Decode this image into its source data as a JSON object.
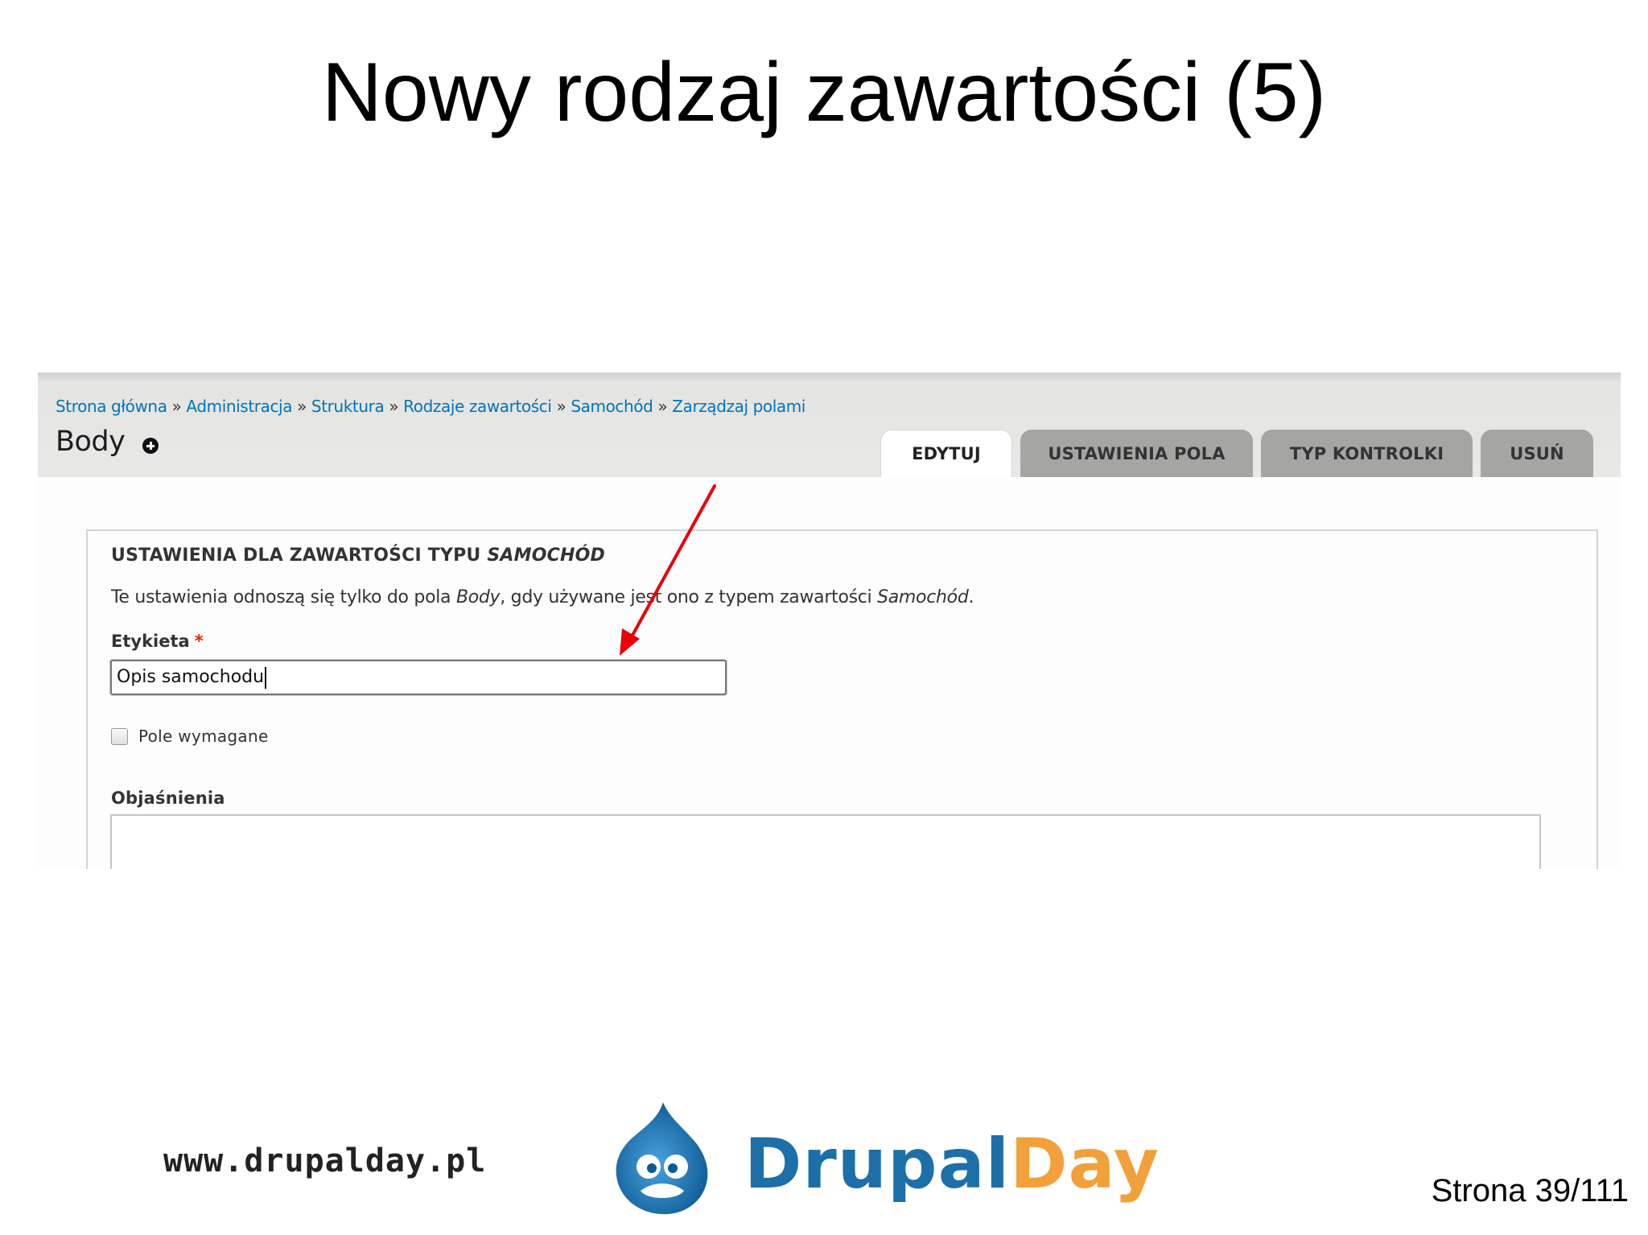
{
  "slide": {
    "title": "Nowy rodzaj zawartości (5)",
    "footer_url": "www.drupalday.pl",
    "logo_word1": "Drupal",
    "logo_word2": "Day",
    "page_number": "Strona 39/111"
  },
  "breadcrumb": {
    "items": [
      "Strona główna",
      "Administracja",
      "Struktura",
      "Rodzaje zawartości",
      "Samochód",
      "Zarządzaj polami"
    ],
    "separator": "»"
  },
  "header": {
    "title": "Body",
    "icon": "plus-circle-icon"
  },
  "tabs": [
    {
      "label": "EDYTUJ",
      "active": true
    },
    {
      "label": "USTAWIENIA POLA",
      "active": false
    },
    {
      "label": "TYP KONTROLKI",
      "active": false
    },
    {
      "label": "USUŃ",
      "active": false
    }
  ],
  "form": {
    "legend_prefix": "USTAWIENIA DLA ZAWARTOŚCI TYPU",
    "legend_type": "SAMOCHÓD",
    "description_part1": "Te ustawienia odnoszą się tylko do pola",
    "description_field": "Body",
    "description_part2": ", gdy używane jest ono z typem zawartości",
    "description_type": "Samochód",
    "description_end": ".",
    "label_field": "Etykieta",
    "required_mark": "*",
    "label_value": "Opis samochodu",
    "checkbox_label": "Pole wymagane",
    "checkbox_checked": false,
    "help_label": "Objaśnienia"
  },
  "colors": {
    "link": "#0074bd",
    "required": "#e32700",
    "arrow": "#e8000b",
    "logo_blue": "#1d6fa8",
    "logo_orange": "#f2a03a"
  }
}
